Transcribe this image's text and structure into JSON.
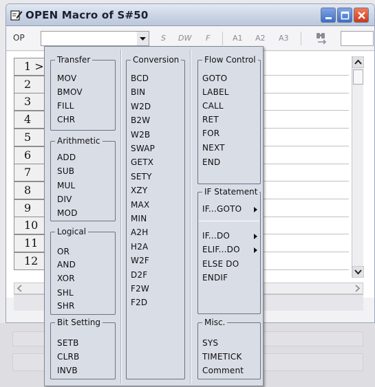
{
  "window": {
    "title": "OPEN Macro of S#50"
  },
  "toolbar": {
    "op_label": "OP",
    "op_value": "",
    "buttons": [
      "S",
      "DW",
      "F",
      "A1",
      "A2",
      "A3"
    ]
  },
  "grid": {
    "rows": [
      "1 >",
      "2",
      "3",
      "4",
      "5",
      "6",
      "7",
      "8",
      "9",
      "10",
      "11",
      "12"
    ]
  },
  "menu": {
    "groups": {
      "transfer": {
        "title": "Transfer",
        "items": [
          "MOV",
          "BMOV",
          "FILL",
          "CHR"
        ]
      },
      "arithmetic": {
        "title": "Arithmetic",
        "items": [
          "ADD",
          "SUB",
          "MUL",
          "DIV",
          "MOD"
        ]
      },
      "logical": {
        "title": "Logical",
        "items": [
          "OR",
          "AND",
          "XOR",
          "SHL",
          "SHR"
        ]
      },
      "bit_setting": {
        "title": "Bit Setting",
        "items": [
          "SETB",
          "CLRB",
          "INVB"
        ]
      },
      "conversion": {
        "title": "Conversion",
        "items": [
          "BCD",
          "BIN",
          "W2D",
          "B2W",
          "W2B",
          "SWAP",
          "GETX",
          "SETY",
          "XZY",
          "MAX",
          "MIN",
          "A2H",
          "H2A",
          "W2F",
          "D2F",
          "F2W",
          "F2D"
        ]
      },
      "flow_control": {
        "title": "Flow Control",
        "items": [
          "GOTO",
          "LABEL",
          "CALL",
          "RET",
          "FOR",
          "NEXT",
          "END"
        ]
      },
      "if_statement": {
        "title": "IF Statement",
        "items": [
          "IF...GOTO",
          "IF...DO",
          "ELIF...DO",
          "ELSE DO",
          "ENDIF"
        ]
      },
      "misc": {
        "title": "Misc.",
        "items": [
          "SYS",
          "TIMETICK",
          "Comment"
        ]
      }
    }
  }
}
